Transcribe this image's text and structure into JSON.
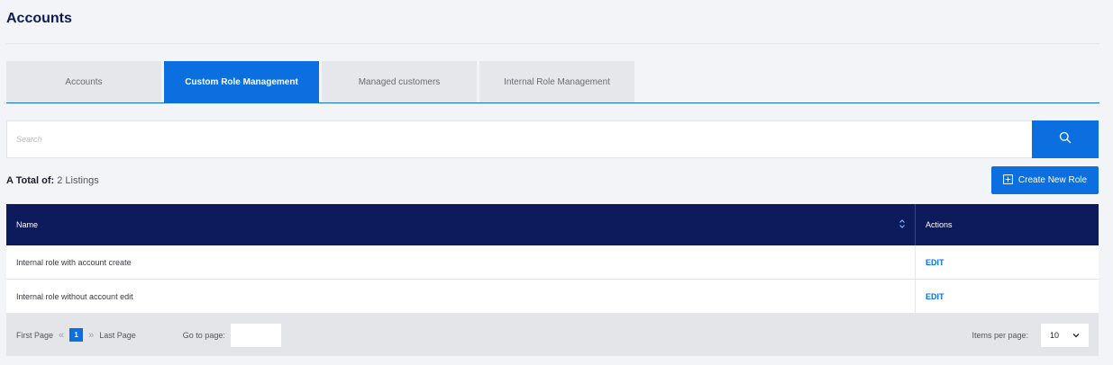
{
  "header": {
    "title": "Accounts"
  },
  "tabs": [
    {
      "label": "Accounts",
      "active": false
    },
    {
      "label": "Custom Role Management",
      "active": true
    },
    {
      "label": "Managed customers",
      "active": false
    },
    {
      "label": "Internal Role Management",
      "active": false
    }
  ],
  "search": {
    "placeholder": "Search",
    "value": "",
    "icon": "search-icon"
  },
  "summary": {
    "label": "A Total of:",
    "count": "2 Listings"
  },
  "create_button": {
    "label": "Create New Role",
    "icon": "plus-square-icon"
  },
  "table": {
    "columns": {
      "name": "Name",
      "actions": "Actions"
    },
    "rows": [
      {
        "name": "Internal role with account create",
        "action": "EDIT"
      },
      {
        "name": "Internal role without account edit",
        "action": "EDIT"
      }
    ]
  },
  "pagination": {
    "first": "First Page",
    "last": "Last Page",
    "current_page": "1",
    "goto_label": "Go to page:",
    "goto_value": "",
    "items_per_page_label": "Items per page:",
    "items_per_page": "10"
  },
  "colors": {
    "accent": "#0b6fe0",
    "header_navy": "#0d1a5c",
    "title": "#0d1a57"
  }
}
